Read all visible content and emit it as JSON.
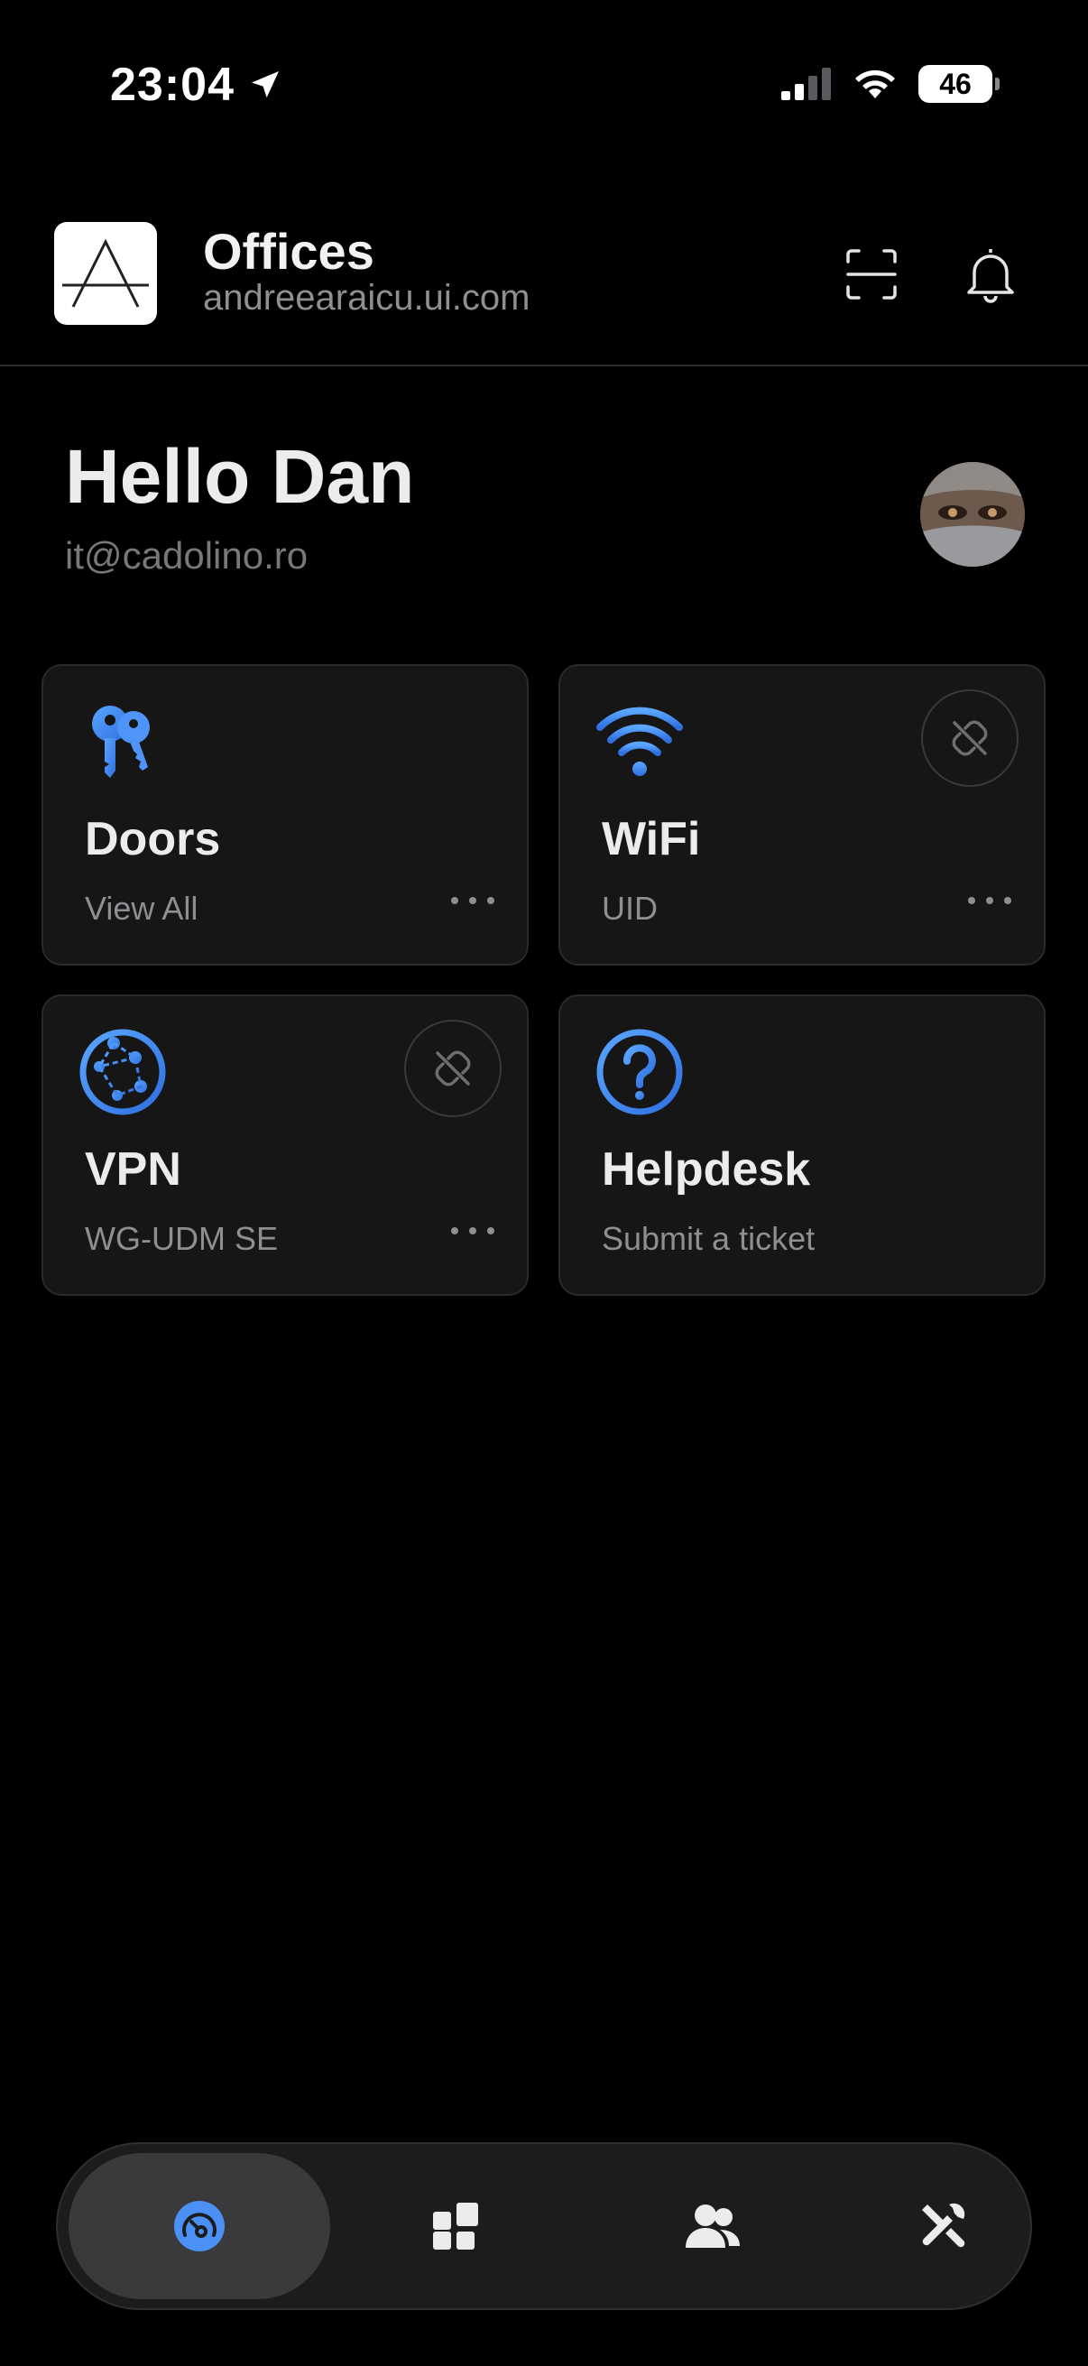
{
  "status_bar": {
    "time": "23:04",
    "battery": "46"
  },
  "header": {
    "site_name": "Offices",
    "site_url": "andreearaicu.ui.com"
  },
  "greeting": {
    "title": "Hello Dan",
    "email": "it@cadolino.ro"
  },
  "cards": [
    {
      "title": "Doors",
      "subtitle": "View All",
      "icon": "keys-icon"
    },
    {
      "title": "WiFi",
      "subtitle": "UID",
      "icon": "wifi-icon"
    },
    {
      "title": "VPN",
      "subtitle": "WG-UDM SE",
      "icon": "vpn-network-icon"
    },
    {
      "title": "Helpdesk",
      "subtitle": "Submit a ticket",
      "icon": "help-icon"
    }
  ],
  "tabs": [
    {
      "icon": "dashboard-gauge-icon",
      "active": true
    },
    {
      "icon": "apps-grid-icon",
      "active": false
    },
    {
      "icon": "users-icon",
      "active": false
    },
    {
      "icon": "tools-icon",
      "active": false
    }
  ],
  "colors": {
    "accent": "#4a90f5",
    "background": "#000000",
    "card": "#161617"
  }
}
